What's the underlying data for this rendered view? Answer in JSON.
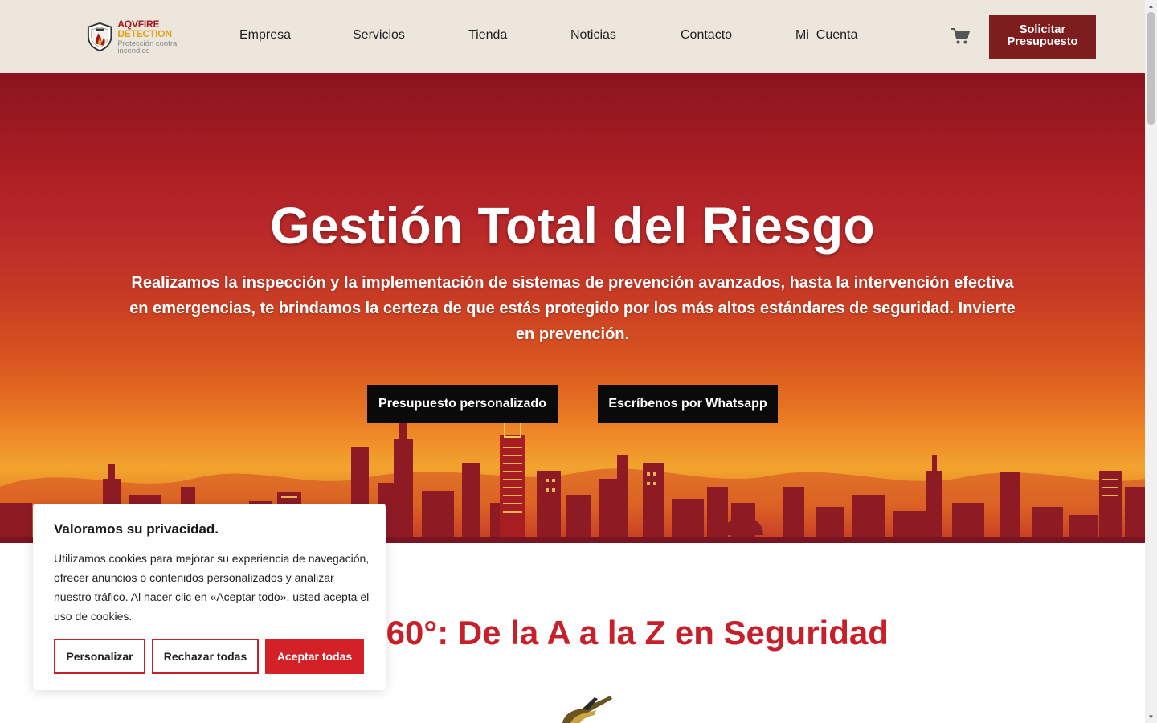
{
  "header": {
    "logo": {
      "brand_part1": "AQVFIRE",
      "brand_part2": "DETECTION",
      "tagline": "Protección contra incendios"
    },
    "nav": [
      "Empresa",
      "Servicios",
      "Tienda",
      "Noticias",
      "Contacto",
      "Mi  Cuenta"
    ],
    "cart_icon": "shopping-cart-icon",
    "cta_line1": "Solicitar",
    "cta_line2": "Presupuesto"
  },
  "hero": {
    "title": "Gestión Total del Riesgo",
    "subtitle": "Realizamos la inspección y la implementación de sistemas de prevención avanzados, hasta la intervención efectiva en emergencias, te brindamos la certeza de que estás protegido por los más altos estándares de seguridad.",
    "subtitle_emphasis": "Invierte en prevención.",
    "button_quote": "Presupuesto personalizado",
    "button_whatsapp": "Escríbenos por Whatsapp"
  },
  "section": {
    "title": "n 360°: De la A a la Z en Seguridad"
  },
  "cookie_banner": {
    "title": "Valoramos su privacidad.",
    "text": "Utilizamos cookies para mejorar su experiencia de navegación, ofrecer anuncios o contenidos personalizados y analizar nuestro tráfico. Al hacer clic en «Aceptar todo», usted acepta el uso de cookies.",
    "btn_customize": "Personalizar",
    "btn_reject": "Rechazar todas",
    "btn_accept": "Aceptar todas"
  },
  "colors": {
    "header_bg": "#ede6dc",
    "brand_dark_red": "#7d1d1d",
    "accent_red": "#c8202a",
    "accept_red": "#d42027"
  }
}
